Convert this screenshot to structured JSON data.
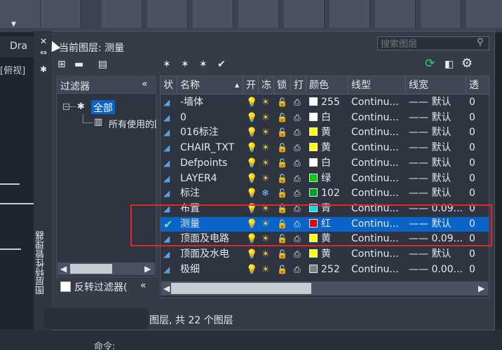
{
  "background": {
    "tab_label": "Dra",
    "view_label": "[俯视]",
    "command_label": "命令:"
  },
  "palette": {
    "title_vertical": "图层特性管理器",
    "current_layer": "当前图层: 测量",
    "search_placeholder": "搜索图层",
    "footer": "图层, 共 22 个图层",
    "toolbar": {
      "new_property_filter": "new-property-filter",
      "new_group_filter": "new-group-filter",
      "layer_states_manager": "layer-states-manager",
      "new_layer": "new-layer",
      "new_layer_vp_frozen": "new-layer-vp-frozen",
      "delete_layer": "delete-layer",
      "set_current": "set-current",
      "refresh": "refresh",
      "settings": "settings"
    }
  },
  "filters": {
    "title": "过滤器",
    "all": "全部",
    "all_used": "所有使用的图层",
    "invert_label": "反转过滤器(",
    "invert_checked": false
  },
  "table": {
    "columns": [
      "状",
      "名称",
      "开",
      "冻",
      "锁",
      "打",
      "颜色",
      "线型",
      "线宽",
      "透"
    ],
    "rows": [
      {
        "name": "-墙体",
        "freeze": "sun",
        "color": "#ffffff",
        "color_label": "255",
        "linetype": "Continu...",
        "lineweight": "—— 默认",
        "transp": "0",
        "selected": false
      },
      {
        "name": "0",
        "freeze": "sun",
        "color": "#ffffff",
        "color_label": "白",
        "linetype": "Continu...",
        "lineweight": "—— 默认",
        "transp": "0",
        "selected": false
      },
      {
        "name": "016标注",
        "freeze": "sun",
        "color": "#ffff00",
        "color_label": "黄",
        "linetype": "Continu...",
        "lineweight": "—— 默认",
        "transp": "0",
        "selected": false
      },
      {
        "name": "CHAIR_TXT",
        "freeze": "sun",
        "color": "#ffff00",
        "color_label": "黄",
        "linetype": "Continu...",
        "lineweight": "—— 默认",
        "transp": "0",
        "selected": false
      },
      {
        "name": "Defpoints",
        "freeze": "sun",
        "color": "#ffffff",
        "color_label": "白",
        "linetype": "Continu...",
        "lineweight": "—— 默认",
        "transp": "0",
        "selected": false
      },
      {
        "name": "LAYER4",
        "freeze": "sun",
        "color": "#00d000",
        "color_label": "绿",
        "linetype": "Continu...",
        "lineweight": "—— 默认",
        "transp": "0",
        "selected": false
      },
      {
        "name": "标注",
        "freeze": "snow",
        "color": "#00a020",
        "color_label": "102",
        "linetype": "Continu...",
        "lineweight": "—— 默认",
        "transp": "0",
        "selected": false
      },
      {
        "name": "布置",
        "freeze": "sun",
        "color": "#00e0e0",
        "color_label": "青",
        "linetype": "Continu...",
        "lineweight": "—— 0.09...",
        "transp": "0",
        "selected": false
      },
      {
        "name": "测量",
        "freeze": "sun",
        "color": "#e00000",
        "color_label": "红",
        "linetype": "Continu...",
        "lineweight": "—— 默认",
        "transp": "0",
        "selected": true
      },
      {
        "name": "顶面及电路",
        "freeze": "sun",
        "color": "#ffff00",
        "color_label": "黄",
        "linetype": "Continu...",
        "lineweight": "—— 0.09...",
        "transp": "0",
        "selected": false
      },
      {
        "name": "顶面及水电",
        "freeze": "sun",
        "color": "#ffff00",
        "color_label": "黄",
        "linetype": "Continu...",
        "lineweight": "—— 默认",
        "transp": "0",
        "selected": false
      },
      {
        "name": "极细",
        "freeze": "sun",
        "color": "#808080",
        "color_label": "252",
        "linetype": "Continu...",
        "lineweight": "—— 0.00...",
        "transp": "0",
        "selected": false
      }
    ]
  },
  "colors": {
    "selection": "#0a64c8",
    "highlight_box": "#e0282b",
    "panel_bg": "#353c48"
  }
}
